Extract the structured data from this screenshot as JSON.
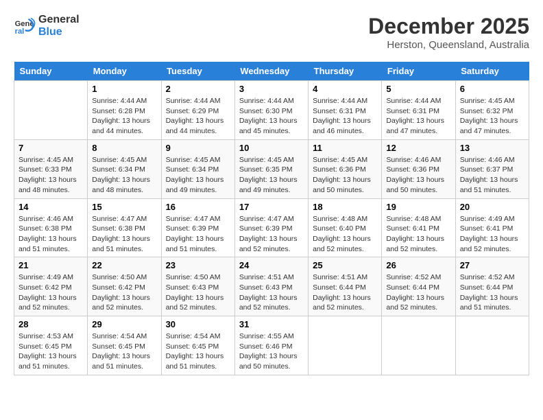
{
  "header": {
    "logo_line1": "General",
    "logo_line2": "Blue",
    "title": "December 2025",
    "subtitle": "Herston, Queensland, Australia"
  },
  "weekdays": [
    "Sunday",
    "Monday",
    "Tuesday",
    "Wednesday",
    "Thursday",
    "Friday",
    "Saturday"
  ],
  "weeks": [
    [
      {
        "day": "",
        "info": ""
      },
      {
        "day": "1",
        "info": "Sunrise: 4:44 AM\nSunset: 6:28 PM\nDaylight: 13 hours\nand 44 minutes."
      },
      {
        "day": "2",
        "info": "Sunrise: 4:44 AM\nSunset: 6:29 PM\nDaylight: 13 hours\nand 44 minutes."
      },
      {
        "day": "3",
        "info": "Sunrise: 4:44 AM\nSunset: 6:30 PM\nDaylight: 13 hours\nand 45 minutes."
      },
      {
        "day": "4",
        "info": "Sunrise: 4:44 AM\nSunset: 6:31 PM\nDaylight: 13 hours\nand 46 minutes."
      },
      {
        "day": "5",
        "info": "Sunrise: 4:44 AM\nSunset: 6:31 PM\nDaylight: 13 hours\nand 47 minutes."
      },
      {
        "day": "6",
        "info": "Sunrise: 4:45 AM\nSunset: 6:32 PM\nDaylight: 13 hours\nand 47 minutes."
      }
    ],
    [
      {
        "day": "7",
        "info": "Sunrise: 4:45 AM\nSunset: 6:33 PM\nDaylight: 13 hours\nand 48 minutes."
      },
      {
        "day": "8",
        "info": "Sunrise: 4:45 AM\nSunset: 6:34 PM\nDaylight: 13 hours\nand 48 minutes."
      },
      {
        "day": "9",
        "info": "Sunrise: 4:45 AM\nSunset: 6:34 PM\nDaylight: 13 hours\nand 49 minutes."
      },
      {
        "day": "10",
        "info": "Sunrise: 4:45 AM\nSunset: 6:35 PM\nDaylight: 13 hours\nand 49 minutes."
      },
      {
        "day": "11",
        "info": "Sunrise: 4:45 AM\nSunset: 6:36 PM\nDaylight: 13 hours\nand 50 minutes."
      },
      {
        "day": "12",
        "info": "Sunrise: 4:46 AM\nSunset: 6:36 PM\nDaylight: 13 hours\nand 50 minutes."
      },
      {
        "day": "13",
        "info": "Sunrise: 4:46 AM\nSunset: 6:37 PM\nDaylight: 13 hours\nand 51 minutes."
      }
    ],
    [
      {
        "day": "14",
        "info": "Sunrise: 4:46 AM\nSunset: 6:38 PM\nDaylight: 13 hours\nand 51 minutes."
      },
      {
        "day": "15",
        "info": "Sunrise: 4:47 AM\nSunset: 6:38 PM\nDaylight: 13 hours\nand 51 minutes."
      },
      {
        "day": "16",
        "info": "Sunrise: 4:47 AM\nSunset: 6:39 PM\nDaylight: 13 hours\nand 51 minutes."
      },
      {
        "day": "17",
        "info": "Sunrise: 4:47 AM\nSunset: 6:39 PM\nDaylight: 13 hours\nand 52 minutes."
      },
      {
        "day": "18",
        "info": "Sunrise: 4:48 AM\nSunset: 6:40 PM\nDaylight: 13 hours\nand 52 minutes."
      },
      {
        "day": "19",
        "info": "Sunrise: 4:48 AM\nSunset: 6:41 PM\nDaylight: 13 hours\nand 52 minutes."
      },
      {
        "day": "20",
        "info": "Sunrise: 4:49 AM\nSunset: 6:41 PM\nDaylight: 13 hours\nand 52 minutes."
      }
    ],
    [
      {
        "day": "21",
        "info": "Sunrise: 4:49 AM\nSunset: 6:42 PM\nDaylight: 13 hours\nand 52 minutes."
      },
      {
        "day": "22",
        "info": "Sunrise: 4:50 AM\nSunset: 6:42 PM\nDaylight: 13 hours\nand 52 minutes."
      },
      {
        "day": "23",
        "info": "Sunrise: 4:50 AM\nSunset: 6:43 PM\nDaylight: 13 hours\nand 52 minutes."
      },
      {
        "day": "24",
        "info": "Sunrise: 4:51 AM\nSunset: 6:43 PM\nDaylight: 13 hours\nand 52 minutes."
      },
      {
        "day": "25",
        "info": "Sunrise: 4:51 AM\nSunset: 6:44 PM\nDaylight: 13 hours\nand 52 minutes."
      },
      {
        "day": "26",
        "info": "Sunrise: 4:52 AM\nSunset: 6:44 PM\nDaylight: 13 hours\nand 52 minutes."
      },
      {
        "day": "27",
        "info": "Sunrise: 4:52 AM\nSunset: 6:44 PM\nDaylight: 13 hours\nand 51 minutes."
      }
    ],
    [
      {
        "day": "28",
        "info": "Sunrise: 4:53 AM\nSunset: 6:45 PM\nDaylight: 13 hours\nand 51 minutes."
      },
      {
        "day": "29",
        "info": "Sunrise: 4:54 AM\nSunset: 6:45 PM\nDaylight: 13 hours\nand 51 minutes."
      },
      {
        "day": "30",
        "info": "Sunrise: 4:54 AM\nSunset: 6:45 PM\nDaylight: 13 hours\nand 51 minutes."
      },
      {
        "day": "31",
        "info": "Sunrise: 4:55 AM\nSunset: 6:46 PM\nDaylight: 13 hours\nand 50 minutes."
      },
      {
        "day": "",
        "info": ""
      },
      {
        "day": "",
        "info": ""
      },
      {
        "day": "",
        "info": ""
      }
    ]
  ]
}
